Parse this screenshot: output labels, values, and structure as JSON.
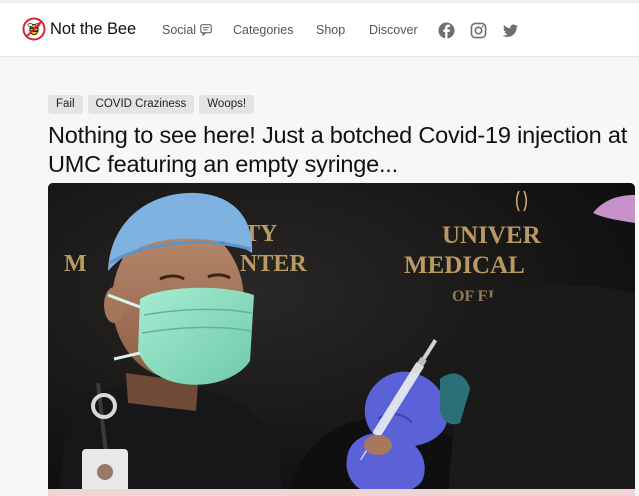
{
  "site": {
    "name": "Not the Bee",
    "logo_icon": "bee-logo-icon"
  },
  "nav": {
    "items": [
      {
        "label": "Social",
        "icon": "chat-bubble-icon"
      },
      {
        "label": "Categories"
      },
      {
        "label": "Shop"
      },
      {
        "label": "Discover"
      }
    ],
    "social_icons": [
      "facebook-icon",
      "instagram-icon",
      "twitter-icon"
    ]
  },
  "article": {
    "tags": [
      "Fail",
      "COVID Craziness",
      "Woops!"
    ],
    "title": "Nothing to see here! Just a botched Covid-19 injection at UMC featuring an empty syringe...",
    "image": {
      "backdrop_text": {
        "left_line1": "TY",
        "left_line2": "M",
        "left_line3": "NTER",
        "right_line1": "UNIVER",
        "right_line2": "MEDICAL",
        "right_line3": "OF EL"
      }
    }
  },
  "colors": {
    "accent_logo": "#d8232a",
    "tag_bg": "#e4e4e4",
    "mask": "#8fe0c4",
    "cap": "#7eb2e0",
    "glove": "#5b61d6",
    "backdrop_gold": "#c9a86a"
  }
}
